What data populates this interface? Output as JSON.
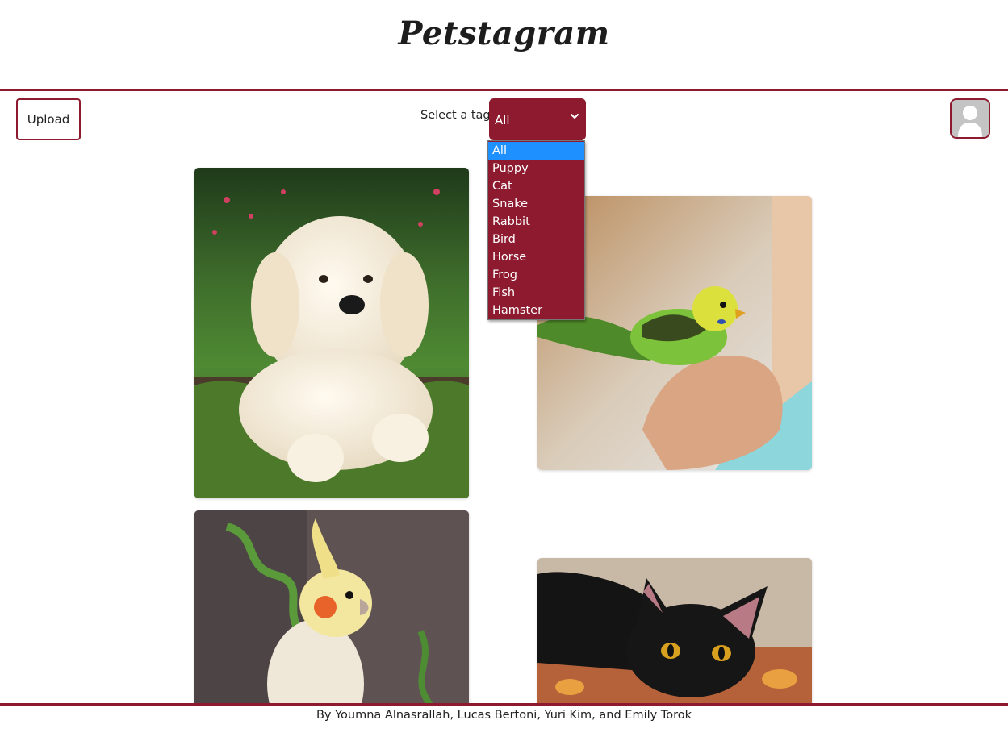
{
  "header": {
    "title": "Petstagram"
  },
  "toolbar": {
    "upload_label": "Upload",
    "tag_label": "Select a tag:",
    "selected_tag": "All",
    "profile_icon": "user-avatar-icon"
  },
  "tag_options": [
    "All",
    "Puppy",
    "Cat",
    "Snake",
    "Rabbit",
    "Bird",
    "Horse",
    "Frog",
    "Fish",
    "Hamster"
  ],
  "feed": {
    "photos": [
      {
        "subject": "puppy"
      },
      {
        "subject": "budgie"
      },
      {
        "subject": "cockatiel"
      },
      {
        "subject": "black-cat"
      }
    ]
  },
  "footer": {
    "credits": "By Youmna Alnasrallah, Lucas Bertoni, Yuri Kim, and Emily Torok"
  },
  "colors": {
    "accent": "#8d1a2e",
    "selected_option": "#1e90ff"
  }
}
